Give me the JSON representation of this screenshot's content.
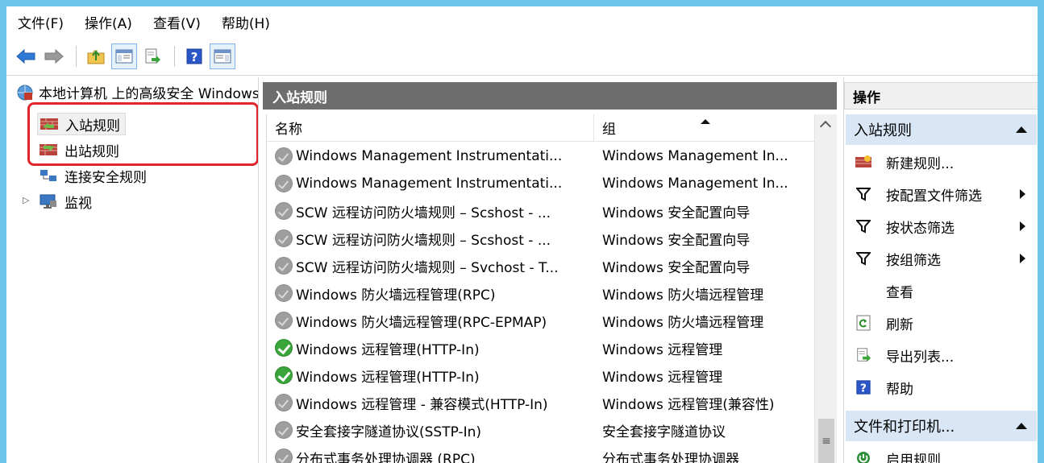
{
  "menu": [
    "文件(F)",
    "操作(A)",
    "查看(V)",
    "帮助(H)"
  ],
  "tree": {
    "root": "本地计算机 上的高级安全 Windows",
    "items": [
      "入站规则",
      "出站规则",
      "连接安全规则",
      "监视"
    ]
  },
  "center": {
    "title": "入站规则",
    "col_name": "名称",
    "col_group": "组",
    "rows": [
      {
        "name": "Windows Management Instrumentati...",
        "group": "Windows Management In...",
        "enabled": false
      },
      {
        "name": "Windows Management Instrumentati...",
        "group": "Windows Management In...",
        "enabled": false
      },
      {
        "name": "SCW 远程访问防火墙规则 – Scshost - ...",
        "group": "Windows 安全配置向导",
        "enabled": false
      },
      {
        "name": "SCW 远程访问防火墙规则 – Scshost - ...",
        "group": "Windows 安全配置向导",
        "enabled": false
      },
      {
        "name": "SCW 远程访问防火墙规则 – Svchost - T...",
        "group": "Windows 安全配置向导",
        "enabled": false
      },
      {
        "name": "Windows 防火墙远程管理(RPC)",
        "group": "Windows 防火墙远程管理",
        "enabled": false
      },
      {
        "name": "Windows 防火墙远程管理(RPC-EPMAP)",
        "group": "Windows 防火墙远程管理",
        "enabled": false
      },
      {
        "name": "Windows 远程管理(HTTP-In)",
        "group": "Windows 远程管理",
        "enabled": true
      },
      {
        "name": "Windows 远程管理(HTTP-In)",
        "group": "Windows 远程管理",
        "enabled": true
      },
      {
        "name": "Windows 远程管理 - 兼容模式(HTTP-In)",
        "group": "Windows 远程管理(兼容性)",
        "enabled": false
      },
      {
        "name": "安全套接字隧道协议(SSTP-In)",
        "group": "安全套接字隧道协议",
        "enabled": false
      },
      {
        "name": "分布式事务处理协调器 (RPC)",
        "group": "分布式事务处理协调器",
        "enabled": false
      }
    ]
  },
  "actions": {
    "title": "操作",
    "section1": "入站规则",
    "items": [
      "新建规则...",
      "按配置文件筛选",
      "按状态筛选",
      "按组筛选",
      "查看",
      "刷新",
      "导出列表...",
      "帮助"
    ],
    "section2": "文件和打印机...",
    "section2_items": [
      "启用规则"
    ]
  },
  "colors": {
    "accent_red": "#e0262c",
    "section_bg": "#d8e6f5",
    "header_gray": "#6d6d6d"
  }
}
